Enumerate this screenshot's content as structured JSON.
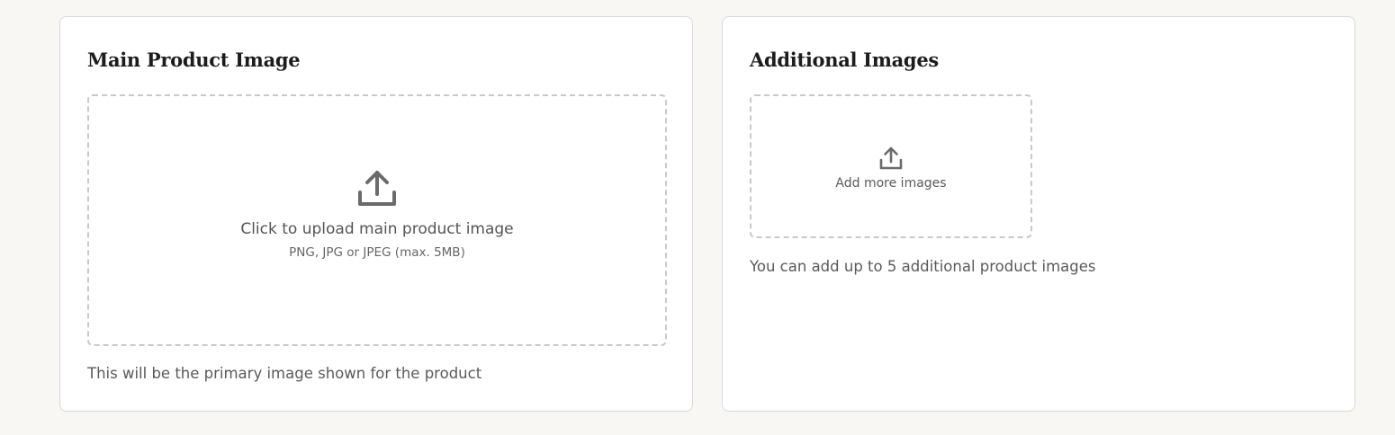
{
  "main_image": {
    "title": "Main Product Image",
    "upload_label": "Click to upload main product image",
    "upload_hint": "PNG, JPG or JPEG (max. 5MB)",
    "helper_text": "This will be the primary image shown for the product",
    "icon": "upload-icon"
  },
  "additional_images": {
    "title": "Additional Images",
    "upload_label": "Add more images",
    "helper_text": "You can add up to 5 additional product images",
    "icon": "upload-icon"
  },
  "colors": {
    "background": "#f8f7f4",
    "card": "#ffffff",
    "border": "#d9d9d9",
    "dashed_border": "#c9c9c9",
    "icon": "#6b6b6b",
    "title": "#1c1c1c"
  }
}
